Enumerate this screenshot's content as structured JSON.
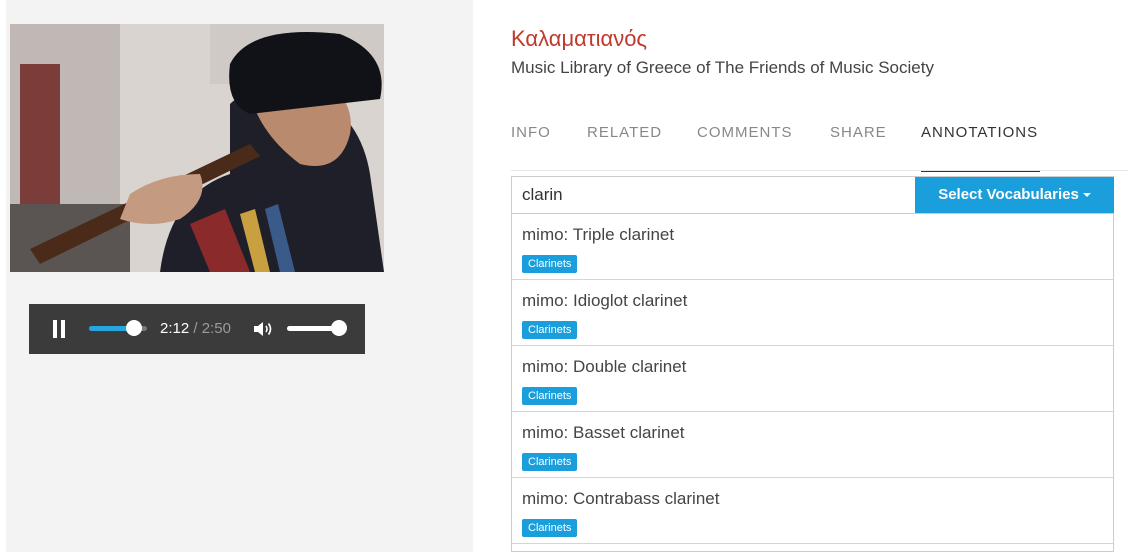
{
  "media": {
    "player": {
      "current_time": "2:12",
      "separator": " / ",
      "duration": "2:50",
      "progress_fraction": 0.776,
      "volume_fraction": 1.0
    }
  },
  "details": {
    "title": "Καλαματιανός",
    "subtitle": "Music Library of Greece of The Friends of Music Society"
  },
  "tabs": [
    {
      "label": "INFO",
      "active": false
    },
    {
      "label": "RELATED",
      "active": false
    },
    {
      "label": "COMMENTS",
      "active": false
    },
    {
      "label": "SHARE",
      "active": false
    },
    {
      "label": "ANNOTATIONS",
      "active": true
    }
  ],
  "annotations": {
    "search_value": "clarin",
    "vocab_button_label": "Select Vocabularies",
    "results": [
      {
        "title": "mimo: Triple clarinet",
        "badge": "Clarinets"
      },
      {
        "title": "mimo: Idioglot clarinet",
        "badge": "Clarinets"
      },
      {
        "title": "mimo: Double clarinet",
        "badge": "Clarinets"
      },
      {
        "title": "mimo: Basset clarinet",
        "badge": "Clarinets"
      },
      {
        "title": "mimo: Contrabass clarinet",
        "badge": "Clarinets"
      }
    ]
  },
  "colors": {
    "title": "#c0392b",
    "accent": "#1b9fdc",
    "player_bg": "#3b3b3b"
  }
}
